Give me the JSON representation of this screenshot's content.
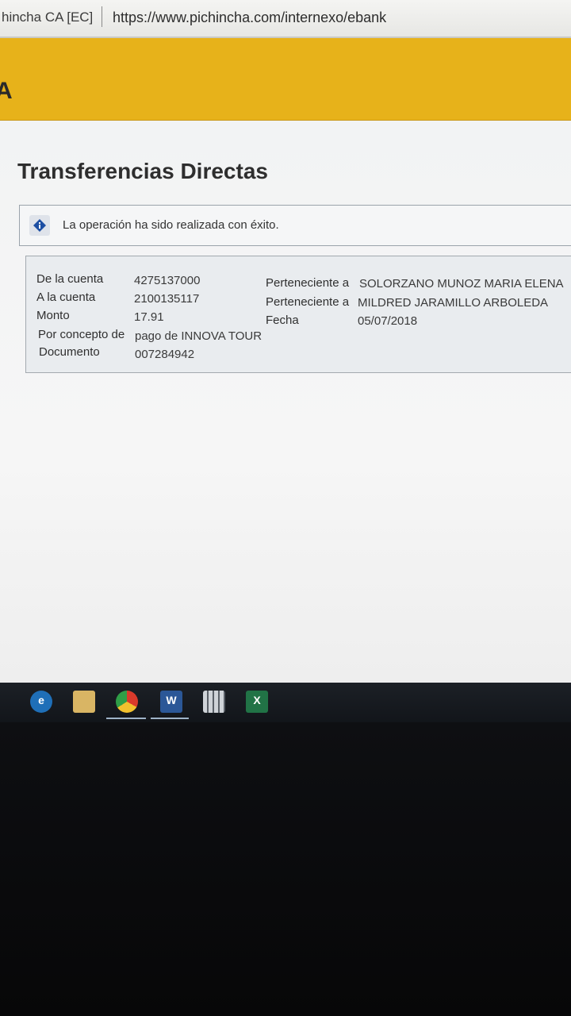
{
  "browser": {
    "site_label": "hincha CA [EC]",
    "url": "https://www.pichincha.com/internexo/ebank"
  },
  "header": {
    "brand_letter": "A",
    "brand_color": "#e7b21a"
  },
  "page": {
    "title": "Transferencias Directas",
    "message": {
      "icon": "info-diamond-icon",
      "text": "La operación ha sido realizada con éxito."
    },
    "details": {
      "from_account_label": "De la cuenta",
      "from_account_value": "4275137000",
      "from_owner_label": "Perteneciente a",
      "from_owner_value": "SOLORZANO MUNOZ MARIA ELENA",
      "to_account_label": "A la cuenta",
      "to_account_value": "2100135117",
      "to_owner_label": "Perteneciente a",
      "to_owner_value": "MILDRED JARAMILLO ARBOLEDA",
      "amount_label": "Monto",
      "amount_value": "17.91",
      "date_label": "Fecha",
      "date_value": "05/07/2018",
      "concept_label": "Por concepto de",
      "concept_value": "pago de INNOVA TOUR",
      "document_label": "Documento",
      "document_value": "007284942"
    }
  },
  "taskbar": {
    "apps": [
      {
        "name": "ie",
        "icon": "internet-explorer-icon"
      },
      {
        "name": "explorer",
        "icon": "file-explorer-icon"
      },
      {
        "name": "chrome",
        "icon": "chrome-icon"
      },
      {
        "name": "word",
        "icon": "word-icon",
        "letter": "W"
      },
      {
        "name": "calculator",
        "icon": "calculator-icon"
      },
      {
        "name": "excel",
        "icon": "excel-icon",
        "letter": "X"
      }
    ]
  }
}
